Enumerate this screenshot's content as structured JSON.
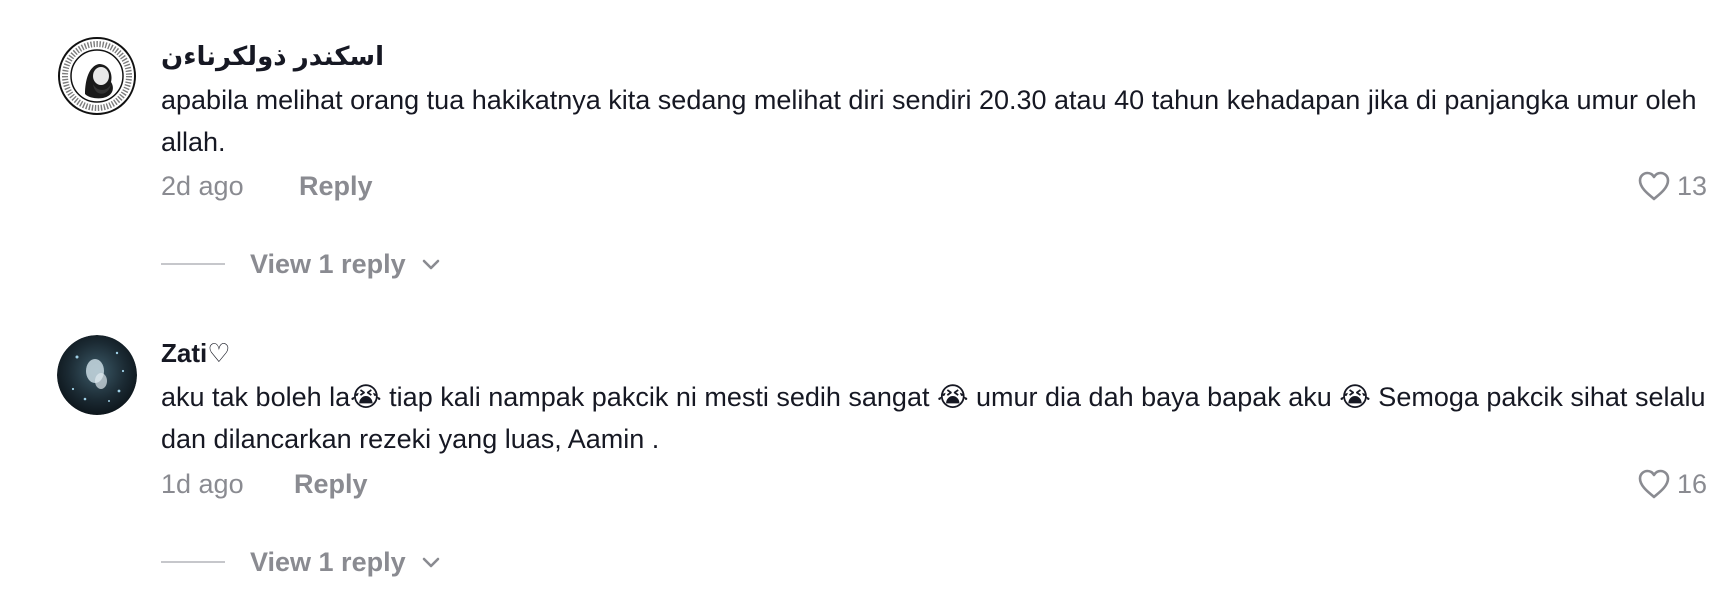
{
  "comments": [
    {
      "username": "اسكندر ذولكرناءن",
      "text": "apabila melihat orang tua hakikatnya kita sedang melihat diri sendiri 20.30 atau 40 tahun kehadapan jika di panjangka umur oleh allah.",
      "timestamp": "2d ago",
      "reply_label": "Reply",
      "likes": "13",
      "view_replies_label": "View 1 reply",
      "avatar_icon": "circular-logo-avatar"
    },
    {
      "username": "Zati♡",
      "text": "aku tak boleh la😭 tiap kali nampak pakcik ni mesti sedih sangat 😭 umur dia dah baya bapak aku 😭 Semoga pakcik sihat selalu dan dilancarkan rezeki yang luas, Aamin .",
      "timestamp": "1d ago",
      "reply_label": "Reply",
      "likes": "16",
      "view_replies_label": "View 1 reply",
      "avatar_icon": "dark-photo-avatar"
    }
  ],
  "colors": {
    "primary_text": "#161823",
    "secondary_text": "#8a8b91",
    "divider": "#c6c7cb"
  },
  "icons": {
    "like": "heart-outline-icon",
    "expand": "chevron-down-icon"
  }
}
